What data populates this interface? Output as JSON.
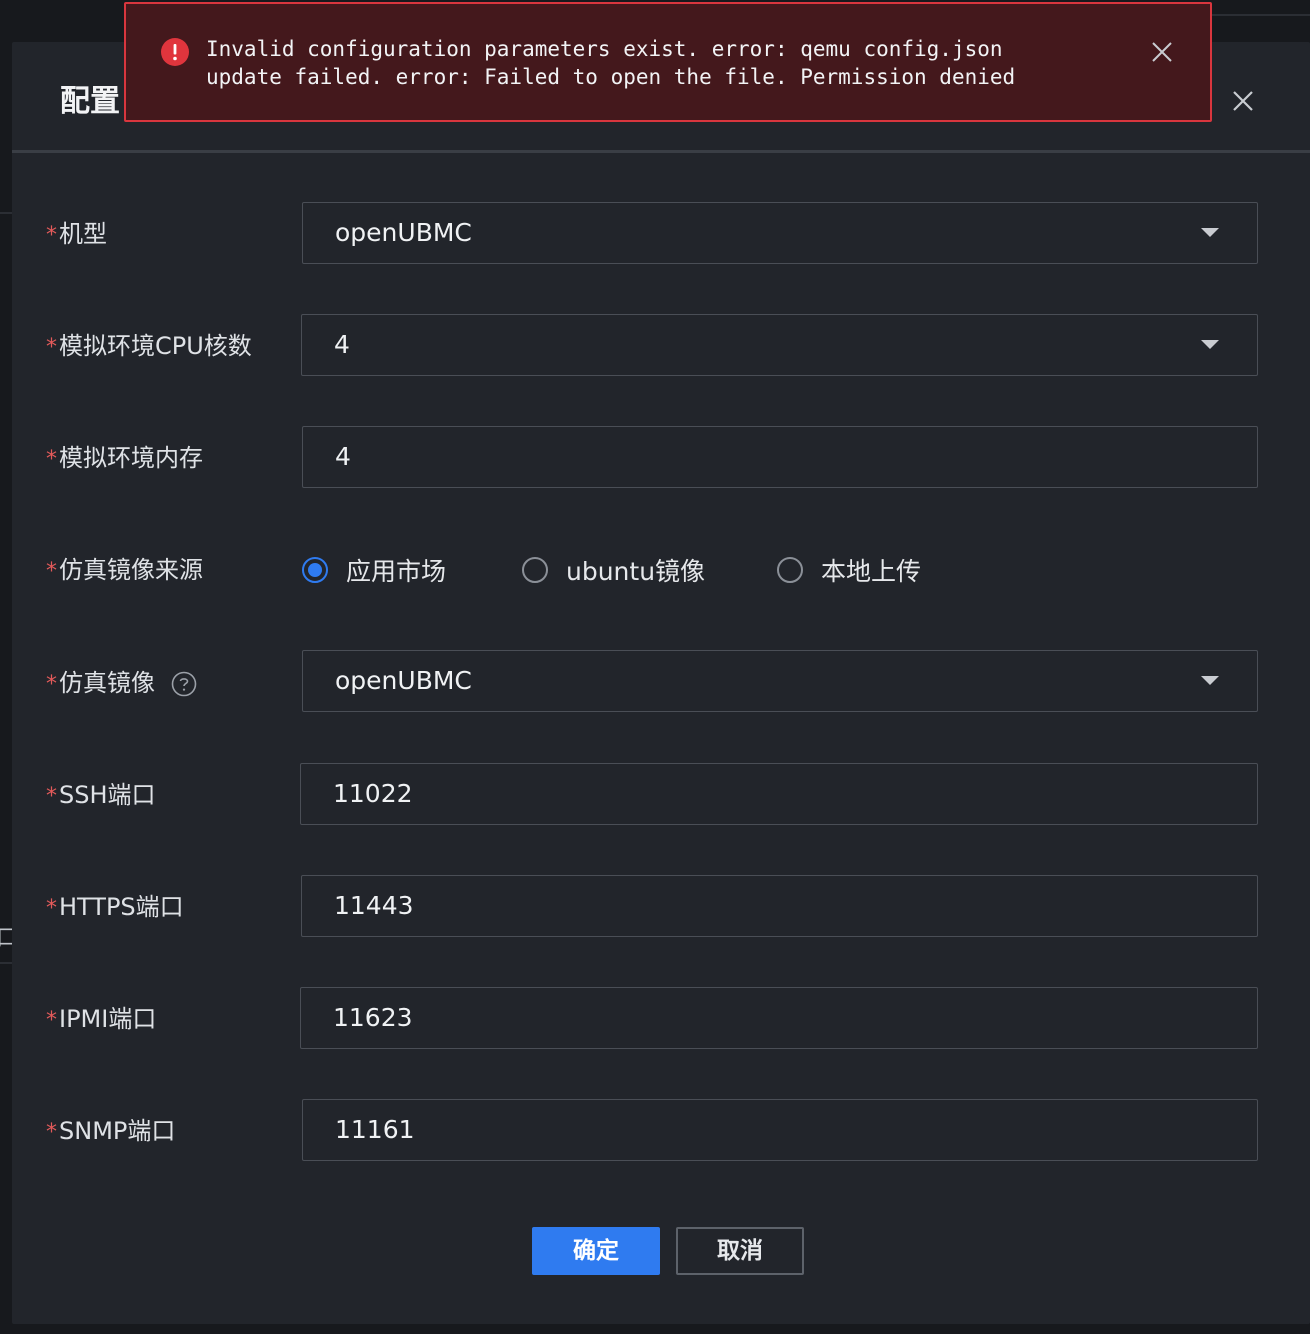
{
  "background": {
    "fragment_text": "口"
  },
  "dialog": {
    "title": "配置",
    "close_icon": "close-icon",
    "fields": {
      "machine_type": {
        "label": "机型",
        "value": "openUBMC"
      },
      "cpu_cores": {
        "label": "模拟环境CPU核数",
        "value": "4"
      },
      "memory": {
        "label": "模拟环境内存",
        "value": "4"
      },
      "image_source": {
        "label": "仿真镜像来源",
        "options": [
          "应用市场",
          "ubuntu镜像",
          "本地上传"
        ],
        "selected": "应用市场"
      },
      "image": {
        "label": "仿真镜像",
        "value": "openUBMC",
        "help_icon": "question-circle-icon"
      },
      "ssh_port": {
        "label": "SSH端口",
        "value": "11022"
      },
      "https_port": {
        "label": "HTTPS端口",
        "value": "11443"
      },
      "ipmi_port": {
        "label": "IPMI端口",
        "value": "11623"
      },
      "snmp_port": {
        "label": "SNMP端口",
        "value": "11161"
      }
    },
    "required_mark": "*",
    "buttons": {
      "confirm": "确定",
      "cancel": "取消"
    }
  },
  "error_toast": {
    "icon": "error-icon",
    "message": "Invalid configuration parameters exist. error: qemu config.json\nupdate failed. error: Failed to open the file. Permission denied"
  },
  "colors": {
    "accent": "#2f7bf0",
    "error_border": "#d9363e",
    "error_bg": "#44181c",
    "required": "#e35a5a",
    "dialog_bg": "#22252b"
  }
}
